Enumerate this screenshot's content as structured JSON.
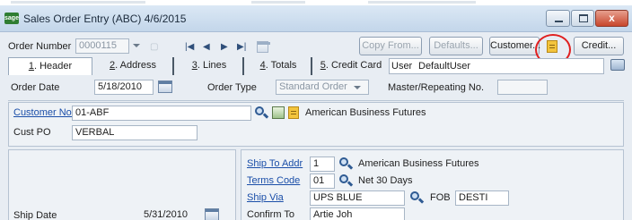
{
  "window": {
    "title": "Sales Order Entry (ABC) 4/6/2015",
    "app_badge": "sage",
    "close_glyph": "x"
  },
  "toolbar": {
    "order_number_label": "Order Number",
    "order_number_value": "0000115",
    "copy_from_label": "Copy From...",
    "defaults_label": "Defaults...",
    "customer_label": "Customer...",
    "credit_label": "Credit..."
  },
  "tabs": [
    {
      "num": "1",
      "label": ". Header"
    },
    {
      "num": "2",
      "label": ". Address"
    },
    {
      "num": "3",
      "label": ". Lines"
    },
    {
      "num": "4",
      "label": ". Totals"
    },
    {
      "num": "5",
      "label": ". Credit Card"
    }
  ],
  "user": {
    "label": "User",
    "value": "DefaultUser"
  },
  "header": {
    "order_date_label": "Order Date",
    "order_date_value": "5/18/2010",
    "order_type_label": "Order Type",
    "order_type_value": "Standard Order",
    "master_label": "Master/Repeating No."
  },
  "customer": {
    "customer_no_label": "Customer No.",
    "customer_no_value": "01-ABF",
    "customer_name": "American Business Futures",
    "cust_po_label": "Cust PO",
    "cust_po_value": "VERBAL"
  },
  "shipping": {
    "ship_date_label": "Ship Date",
    "ship_date_value": "5/31/2010",
    "ship_to_label": "Ship To Addr",
    "ship_to_value": "1",
    "ship_to_name": "American Business Futures",
    "terms_label": "Terms Code",
    "terms_value": "01",
    "terms_desc": "Net 30 Days",
    "ship_via_label": "Ship Via",
    "ship_via_value": "UPS BLUE",
    "fob_label": "FOB",
    "fob_value": "DESTI",
    "confirm_to_label": "Confirm To",
    "confirm_to_value": "Artie Joh"
  },
  "icons": {
    "search": "search-icon",
    "calendar": "calendar-icon",
    "memo": "memo-icon",
    "nav_first": "|◀",
    "nav_prev": "◀",
    "nav_next": "▶",
    "nav_last": "▶|"
  },
  "colors": {
    "highlight": "#e02020",
    "link": "#1a4ea8",
    "titlebar": "#c3d6ea"
  }
}
